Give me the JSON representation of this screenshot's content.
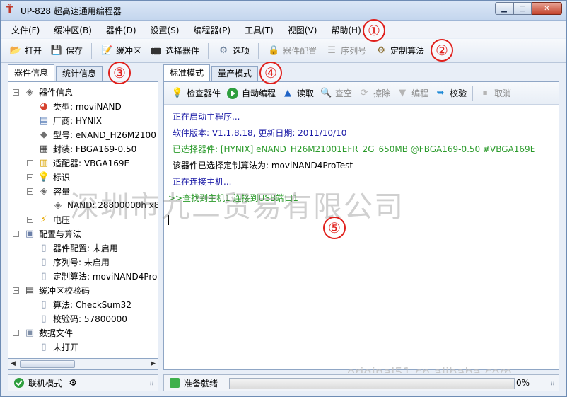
{
  "window": {
    "title": "UP-828 超高速通用编程器",
    "controls": {
      "minimize": "▁",
      "maximize": "□",
      "close": "✕"
    }
  },
  "menu": [
    "文件(F)",
    "缓冲区(B)",
    "器件(D)",
    "设置(S)",
    "编程器(P)",
    "工具(T)",
    "视图(V)",
    "帮助(H)"
  ],
  "toolbar": {
    "open": "打开",
    "save": "保存",
    "buffer": "缓冲区",
    "select_device": "选择器件",
    "options": "选项",
    "device_config": "器件配置",
    "serial": "序列号",
    "custom_algo": "定制算法"
  },
  "annotations": [
    "①",
    "②",
    "③",
    "④",
    "⑤"
  ],
  "left_tabs": [
    "器件信息",
    "统计信息"
  ],
  "tree": [
    {
      "label": "器件信息",
      "depth": 0,
      "expander": "−",
      "icon": "chip-icon"
    },
    {
      "label": "类型: moviNAND",
      "depth": 1,
      "icon": "type-icon"
    },
    {
      "label": "厂商: HYNIX",
      "depth": 1,
      "icon": "vendor-icon"
    },
    {
      "label": "型号: eNAND_H26M2100",
      "depth": 1,
      "icon": "model-icon"
    },
    {
      "label": "封装: FBGA169-0.50",
      "depth": 1,
      "icon": "package-icon"
    },
    {
      "label": "适配器: VBGA169E",
      "depth": 1,
      "expander": "+",
      "icon": "adapter-icon"
    },
    {
      "label": "标识",
      "depth": 1,
      "expander": "+",
      "icon": "bulb-icon"
    },
    {
      "label": "容量",
      "depth": 1,
      "expander": "−",
      "icon": "capacity-icon"
    },
    {
      "label": "NAND: 28800000h x8",
      "depth": 2,
      "icon": "nand-icon"
    },
    {
      "label": "电压",
      "depth": 1,
      "expander": "+",
      "icon": "voltage-icon"
    },
    {
      "label": "配置与算法",
      "depth": 0,
      "expander": "−",
      "icon": "config-icon"
    },
    {
      "label": "器件配置: 未启用",
      "depth": 1,
      "icon": "doc-icon"
    },
    {
      "label": "序列号: 未启用",
      "depth": 1,
      "icon": "doc-icon"
    },
    {
      "label": "定制算法: moviNAND4Pro",
      "depth": 1,
      "icon": "doc-icon"
    },
    {
      "label": "缓冲区校验码",
      "depth": 0,
      "expander": "−",
      "icon": "binary-icon"
    },
    {
      "label": "算法: CheckSum32",
      "depth": 1,
      "icon": "doc-icon"
    },
    {
      "label": "校验码: 57800000",
      "depth": 1,
      "icon": "doc-icon"
    },
    {
      "label": "数据文件",
      "depth": 0,
      "expander": "−",
      "icon": "datafile-icon"
    },
    {
      "label": "未打开",
      "depth": 1,
      "icon": "doc-icon"
    }
  ],
  "right_tabs": [
    "标准模式",
    "量产模式"
  ],
  "actions": {
    "check": "检查器件",
    "auto": "自动编程",
    "read": "读取",
    "blank": "查空",
    "erase": "擦除",
    "program": "编程",
    "verify": "校验",
    "cancel": "取消"
  },
  "log": [
    {
      "text": "正在启动主程序...",
      "color": "#1a1aa6"
    },
    {
      "text": "软件版本: V1.1.8.18, 更新日期: 2011/10/10",
      "color": "#1a1aa6"
    },
    {
      "text": "已选择器件: [HYNIX] eNAND_H26M21001EFR_2G_650MB @FBGA169-0.50 #VBGA169E",
      "color": "#2a9a2a"
    },
    {
      "text": "该器件已选择定制算法为: moviNAND4ProTest",
      "color": "#000000"
    },
    {
      "text": "正在连接主机...",
      "color": "#1a1aa6"
    },
    {
      "text": ">>查找到主机1 连接到USB端口1",
      "color": "#2a9a2a"
    }
  ],
  "watermark": "深圳市九二贸易有限公司",
  "watermark_url": "original51.cn.alibaba.com",
  "status": {
    "mode": "联机模式",
    "ready": "准备就绪",
    "progress": 0,
    "progress_text": "0%"
  }
}
